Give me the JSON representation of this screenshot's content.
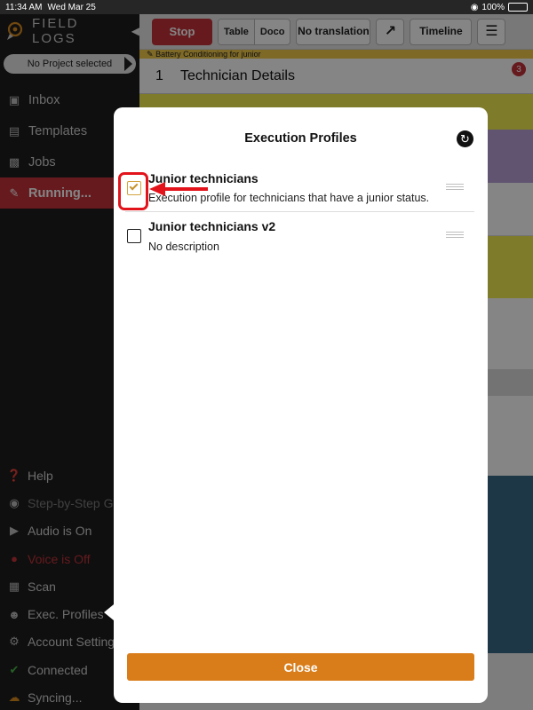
{
  "status_bar": {
    "time": "11:34 AM",
    "date": "Wed Mar 25",
    "battery": "100%"
  },
  "sidebar": {
    "logo": "FIELD LOGS",
    "project": "No Project selected",
    "nav": [
      {
        "label": "Inbox",
        "icon": "inbox-icon"
      },
      {
        "label": "Templates",
        "icon": "templates-icon"
      },
      {
        "label": "Jobs",
        "icon": "briefcase-icon"
      },
      {
        "label": "Running...",
        "icon": "wrench-icon",
        "active": true
      }
    ],
    "bottom": [
      {
        "label": "Help",
        "icon": "help-icon"
      },
      {
        "label": "Step-by-Step G",
        "icon": "map-pin-icon"
      },
      {
        "label": "Audio is On",
        "icon": "speaker-icon"
      },
      {
        "label": "Voice is Off",
        "icon": "microphone-off-icon"
      },
      {
        "label": "Scan",
        "icon": "qr-code-icon"
      },
      {
        "label": "Exec. Profiles",
        "icon": "users-gear-icon"
      },
      {
        "label": "Account Setting",
        "icon": "gear-icon"
      },
      {
        "label": "Connected",
        "icon": "check-icon"
      },
      {
        "label": "Syncing...",
        "icon": "cloud-sync-icon"
      }
    ]
  },
  "toolbar": {
    "stop": "Stop",
    "table": "Table",
    "doco": "Doco",
    "no_translation": "No translation",
    "timeline": "Timeline"
  },
  "document": {
    "header": "Battery Conditioning for junior",
    "section_number": "1",
    "section_title": "Technician Details",
    "section_badge": "3"
  },
  "modal": {
    "title": "Execution Profiles",
    "profiles": [
      {
        "name": "Junior technicians",
        "description": "Execution profile for technicians that have a junior status.",
        "checked": true
      },
      {
        "name": "Junior technicians v2",
        "description": "No description",
        "checked": false
      }
    ],
    "close": "Close"
  },
  "colors": {
    "accent_red": "#c3333b",
    "close_orange": "#d97d1a",
    "highlight_red": "#e3131c",
    "check_gold": "#c8922b"
  }
}
